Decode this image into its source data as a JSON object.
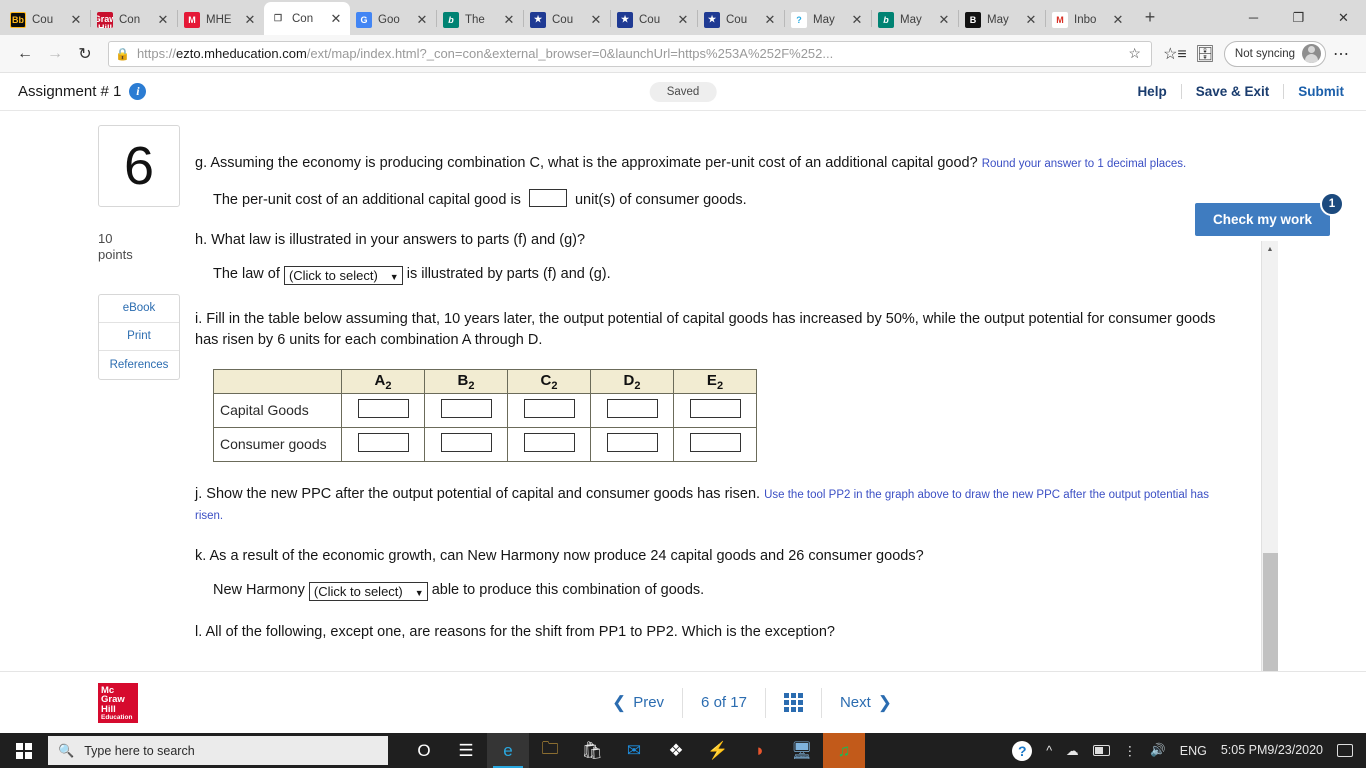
{
  "browser": {
    "tabs": [
      {
        "title": "Cou",
        "favicon": "blackboard-icon",
        "fav_text": "Bb",
        "fav_class": "fav-bb",
        "active": false
      },
      {
        "title": "Con",
        "favicon": "mcgrawhill-icon",
        "fav_text": "Mc Graw Hill",
        "fav_class": "fav-mhe",
        "active": false
      },
      {
        "title": "MHE",
        "favicon": "m-icon",
        "fav_text": "M",
        "fav_class": "fav-m",
        "active": false
      },
      {
        "title": "Con",
        "favicon": "document-icon",
        "fav_text": "❐",
        "fav_class": "fav-doc",
        "active": true
      },
      {
        "title": "Goo",
        "favicon": "google-translate-icon",
        "fav_text": "G",
        "fav_class": "fav-g",
        "active": false
      },
      {
        "title": "The",
        "favicon": "bing-icon",
        "fav_text": "b",
        "fav_class": "fav-bing",
        "active": false
      },
      {
        "title": "Cou",
        "favicon": "shield-icon",
        "fav_text": "★",
        "fav_class": "fav-shield",
        "active": false
      },
      {
        "title": "Cou",
        "favicon": "shield-icon",
        "fav_text": "★",
        "fav_class": "fav-shield",
        "active": false
      },
      {
        "title": "Cou",
        "favicon": "shield-icon",
        "fav_text": "★",
        "fav_class": "fav-shield",
        "active": false
      },
      {
        "title": "May",
        "favicon": "question-circle-icon",
        "fav_text": "?",
        "fav_class": "fav-q",
        "active": false
      },
      {
        "title": "May",
        "favicon": "bing-icon",
        "fav_text": "b",
        "fav_class": "fav-bing",
        "active": false
      },
      {
        "title": "May",
        "favicon": "b-icon",
        "fav_text": "B",
        "fav_class": "fav-b",
        "active": false
      },
      {
        "title": "Inbo",
        "favicon": "gmail-icon",
        "fav_text": "M",
        "fav_class": "fav-gm",
        "active": false
      }
    ],
    "new_tab_label": "+",
    "window_controls": {
      "minimize": "─",
      "maximize": "❐",
      "close": "✕"
    },
    "nav": {
      "back": "←",
      "forward": "→",
      "reload": "↻"
    },
    "address": {
      "lock_icon": "lock-icon",
      "url_prefix": "https://",
      "url_domain": "ezto.mheducation.com",
      "url_rest": "/ext/map/index.html?_con=con&external_browser=0&launchUrl=https%253A%252F%252...",
      "favorite_icon": "star-add-icon",
      "collections_icon": "collections-icon",
      "favorites_bar_icon": "favorites-icon",
      "profile_label": "Not syncing",
      "settings_icon": "ellipsis-icon"
    }
  },
  "app": {
    "title": "Assignment # 1",
    "info_icon": "info-icon",
    "status": "Saved",
    "links": [
      "Help",
      "Save & Exit",
      "Submit"
    ],
    "check_my_work": {
      "label": "Check my work",
      "badge": "1"
    }
  },
  "question": {
    "number": "6",
    "points_value": "10",
    "points_label": "points",
    "side_buttons": [
      "eBook",
      "Print",
      "References"
    ],
    "parts": {
      "g": {
        "text": "g.  Assuming the economy is producing combination C, what is the approximate per-unit cost of an additional capital good?",
        "hint": "Round your answer to 1 decimal places.",
        "answer_prefix": "The per-unit cost of an additional capital good is",
        "answer_value": "",
        "answer_suffix": "unit(s) of consumer goods."
      },
      "h": {
        "text": "h.  What law is illustrated in your answers to parts (f) and (g)?",
        "answer_prefix": "The law of",
        "select_value": "(Click to select)",
        "answer_suffix": "is illustrated by parts (f) and (g)."
      },
      "i": {
        "text": "i. Fill in the table below assuming that, 10 years later, the output potential of capital goods has increased by 50%, while the output potential for consumer goods has risen by 6 units for each combination A through D."
      },
      "j": {
        "text": "j. Show the new PPC after the output potential of capital and consumer goods has risen.",
        "hint": "Use the tool PP2 in the graph above to draw the new PPC after the output potential has risen."
      },
      "k": {
        "text": "k. As a result of the economic growth, can New Harmony now produce 24 capital goods and 26 consumer goods?",
        "answer_prefix": "New Harmony",
        "select_value": "(Click to select)",
        "answer_suffix": "able to produce this combination of goods."
      },
      "l": {
        "text": "l. All of the following, except one, are reasons for the shift from PP1 to PP2.  Which is the exception?"
      }
    },
    "table": {
      "corner": "",
      "columns": [
        "A",
        "B",
        "C",
        "D",
        "E"
      ],
      "column_subscript": "2",
      "rows": [
        {
          "label": "Capital Goods",
          "values": [
            "",
            "",
            "",
            "",
            ""
          ]
        },
        {
          "label": "Consumer goods",
          "values": [
            "",
            "",
            "",
            "",
            ""
          ]
        }
      ]
    }
  },
  "footer": {
    "logo_lines": [
      "Mc",
      "Graw",
      "Hill"
    ],
    "logo_sub": "Education",
    "prev_label": "Prev",
    "prev_icon": "chevron-left-icon",
    "page_current": "6",
    "page_of": "of",
    "page_total": "17",
    "grid_icon": "grid-icon",
    "next_label": "Next",
    "next_icon": "chevron-right-icon"
  },
  "taskbar": {
    "start_icon": "windows-start-icon",
    "search_placeholder": "Type here to search",
    "search_icon": "search-icon",
    "apps": [
      {
        "name": "cortana-icon",
        "glyph": "O"
      },
      {
        "name": "task-view-icon",
        "glyph": "☰"
      },
      {
        "name": "edge-icon",
        "glyph": "e"
      },
      {
        "name": "file-explorer-icon",
        "glyph": "🗀"
      },
      {
        "name": "microsoft-store-icon",
        "glyph": "🛍"
      },
      {
        "name": "mail-icon",
        "glyph": "✉"
      },
      {
        "name": "dropbox-icon",
        "glyph": "❖"
      },
      {
        "name": "shareit-icon",
        "glyph": "⚡"
      },
      {
        "name": "office-icon",
        "glyph": "◗"
      },
      {
        "name": "remote-desktop-icon",
        "glyph": "🖥"
      },
      {
        "name": "spotify-icon",
        "glyph": "♫"
      }
    ],
    "tray": {
      "help_icon": "help-circle-icon",
      "chevron_icon": "chevron-up-icon",
      "onedrive_icon": "onedrive-icon",
      "battery_icon": "battery-icon",
      "wifi_icon": "wifi-icon",
      "volume_icon": "volume-icon",
      "language": "ENG",
      "time": "5:05 PM",
      "date": "9/23/2020",
      "notifications_icon": "notification-icon"
    }
  }
}
